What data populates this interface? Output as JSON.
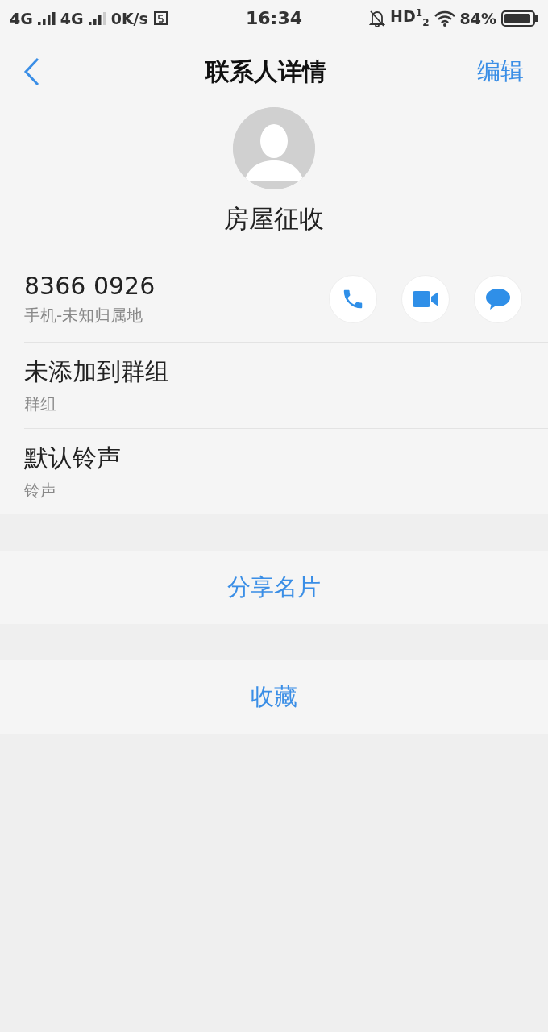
{
  "status_bar": {
    "network_1": "4G",
    "network_2": "4G",
    "speed": "0K/s",
    "time": "16:34",
    "hd": "HD$^{1}$$_{2}$",
    "battery": "84%"
  },
  "header": {
    "title": "联系人详情",
    "action": "编辑"
  },
  "contact": {
    "name": "房屋征收"
  },
  "details": [
    {
      "kind": "phone",
      "value": "8366 0926",
      "label": "手机-未知归属地"
    },
    {
      "kind": "plain",
      "value": "未添加到群组",
      "label": "群组"
    },
    {
      "kind": "plain",
      "value": "默认铃声",
      "label": "铃声"
    }
  ],
  "actions": [
    "分享名片",
    "收藏"
  ]
}
